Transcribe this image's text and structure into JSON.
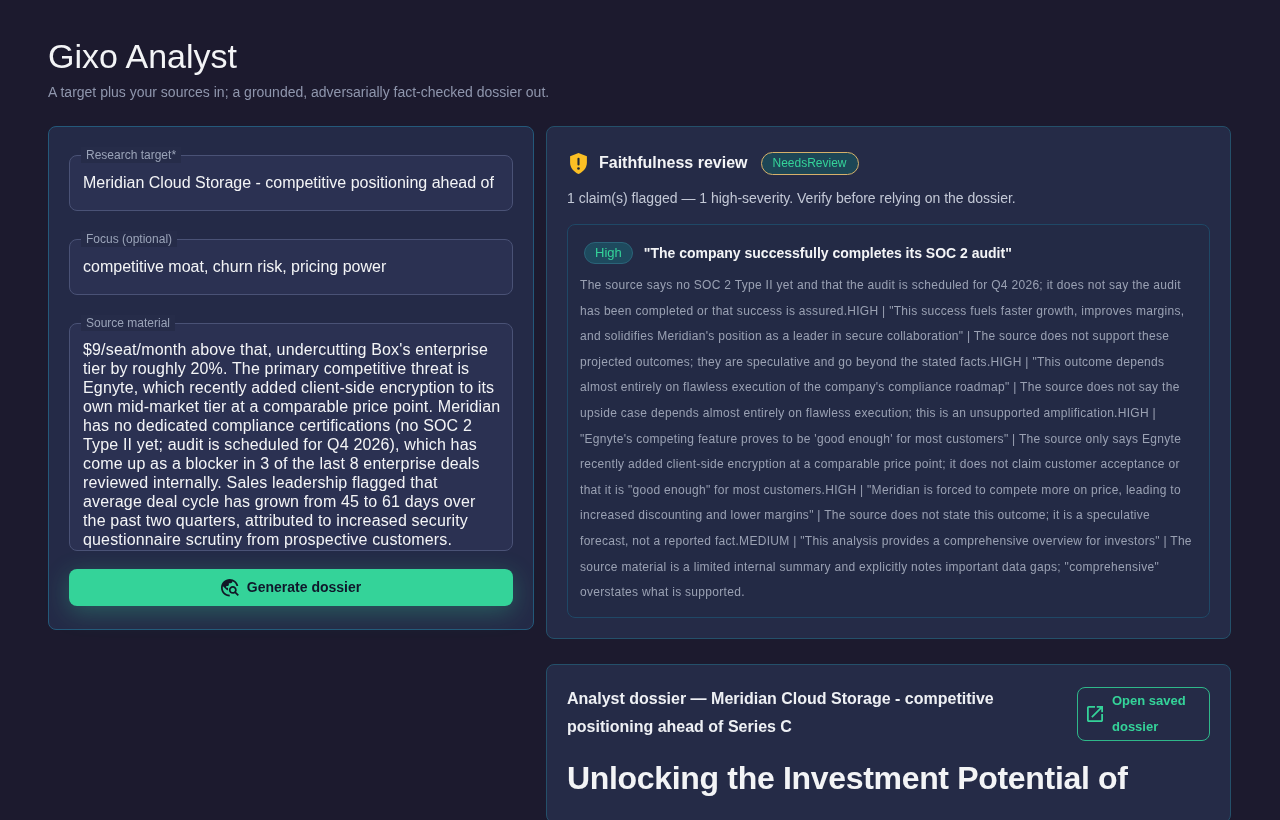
{
  "app": {
    "title": "Gixo Analyst",
    "subtitle": "A target plus your sources in; a grounded, adversarially fact-checked dossier out."
  },
  "form": {
    "fields": [
      {
        "kind": "input",
        "label": "Research target*",
        "value": "Meridian Cloud Storage - competitive positioning ahead of"
      },
      {
        "kind": "input",
        "label": "Focus (optional)",
        "value": "competitive moat, churn risk, pricing power"
      },
      {
        "kind": "textarea",
        "label": "Source material",
        "value": "$9/seat/month above that, undercutting Box's enterprise tier by roughly 20%. The primary competitive threat is Egnyte, which recently added client-side encryption to its own mid-market tier at a comparable price point. Meridian has no dedicated compliance certifications (no SOC 2 Type II yet; audit is scheduled for Q4 2026), which has come up as a blocker in 3 of the last 8 enterprise deals reviewed internally. Sales leadership flagged that average deal cycle has grown from 45 to 61 days over the past two quarters, attributed to increased security questionnaire scrutiny from prospective customers."
      }
    ],
    "submit_button": "Generate dossier"
  },
  "review": {
    "title": "Faithfulness review",
    "status_badge": "NeedsReview",
    "summary": "1 claim(s) flagged — 1 high-severity. Verify before relying on the dossier.",
    "claims": [
      {
        "severity": "High",
        "claim": "\"The company successfully completes its SOC 2 audit\"",
        "explanation": "The source says no SOC 2 Type II yet and that the audit is scheduled for Q4 2026; it does not say the audit has been completed or that success is assured.HIGH | \"This success fuels faster growth, improves margins, and solidifies Meridian's position as a leader in secure collaboration\" | The source does not support these projected outcomes; they are speculative and go beyond the stated facts.HIGH | \"This outcome depends almost entirely on flawless execution of the company's compliance roadmap\" | The source does not say the upside case depends almost entirely on flawless execution; this is an unsupported amplification.HIGH | \"Egnyte's competing feature proves to be 'good enough' for most customers\" | The source only says Egnyte recently added client-side encryption at a comparable price point; it does not claim customer acceptance or that it is \"good enough\" for most customers.HIGH | \"Meridian is forced to compete more on price, leading to increased discounting and lower margins\" | The source does not state this outcome; it is a speculative forecast, not a reported fact.MEDIUM | \"This analysis provides a comprehensive overview for investors\" | The source material is a limited internal summary and explicitly notes important data gaps; \"comprehensive\" overstates what is supported."
      }
    ]
  },
  "dossier": {
    "header": "Analyst dossier — Meridian Cloud Storage - competitive positioning ahead of Series C",
    "open_button": "Open saved dossier",
    "heading": "Unlocking the Investment Potential of"
  }
}
